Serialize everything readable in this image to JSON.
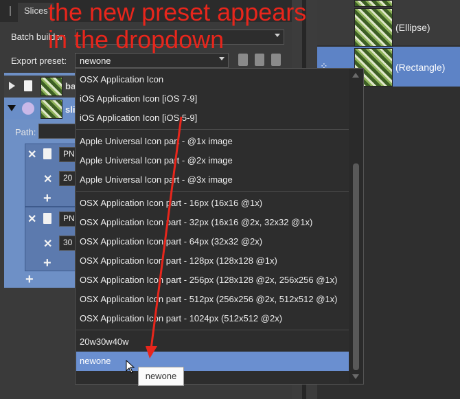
{
  "slices_panel": {
    "tab_label": "Slices",
    "batch_builder_label": "Batch builder:",
    "batch_builder_value": "",
    "export_preset_label": "Export preset:",
    "export_preset_value": "newone",
    "path_label": "Path:",
    "rows": [
      {
        "name_partial": "ba"
      },
      {
        "name_partial": "sli"
      }
    ],
    "sub_entries": [
      {
        "format_partial": "PN",
        "scale_partial": "20"
      },
      {
        "format_partial": "PN",
        "scale_partial": "30"
      }
    ]
  },
  "layers_panel": {
    "layers": [
      {
        "label": "(Ellipse)"
      },
      {
        "label": "(Rectangle)"
      }
    ]
  },
  "dropdown": {
    "groups": [
      [
        "OSX Application Icon",
        "iOS Application Icon [iOS 7-9]",
        "iOS Application Icon [iOS 5-9]"
      ],
      [
        "Apple Universal Icon part - @1x image",
        "Apple Universal Icon part - @2x image",
        "Apple Universal Icon part - @3x image"
      ],
      [
        "OSX Application Icon part - 16px (16x16 @1x)",
        "OSX Application Icon part - 32px (16x16 @2x, 32x32 @1x)",
        "OSX Application Icon part - 64px (32x32 @2x)",
        "OSX Application Icon part - 128px (128x128 @1x)",
        "OSX Application Icon part - 256px (128x128 @2x, 256x256 @1x)",
        "OSX Application Icon part - 512px (256x256 @2x, 512x512 @1x)",
        "OSX Application Icon part - 1024px (512x512 @2x)"
      ],
      [
        "20w30w40w",
        "newone"
      ]
    ],
    "selected": "newone"
  },
  "tooltip": "newone",
  "annotation": {
    "line1": "the new preset appears",
    "line2": "in the dropdown",
    "color": "#e8261c"
  },
  "colors": {
    "selection": "#6a8fd0",
    "panel_bg": "#3a3a3a",
    "list_bg": "#2d2d2d"
  }
}
